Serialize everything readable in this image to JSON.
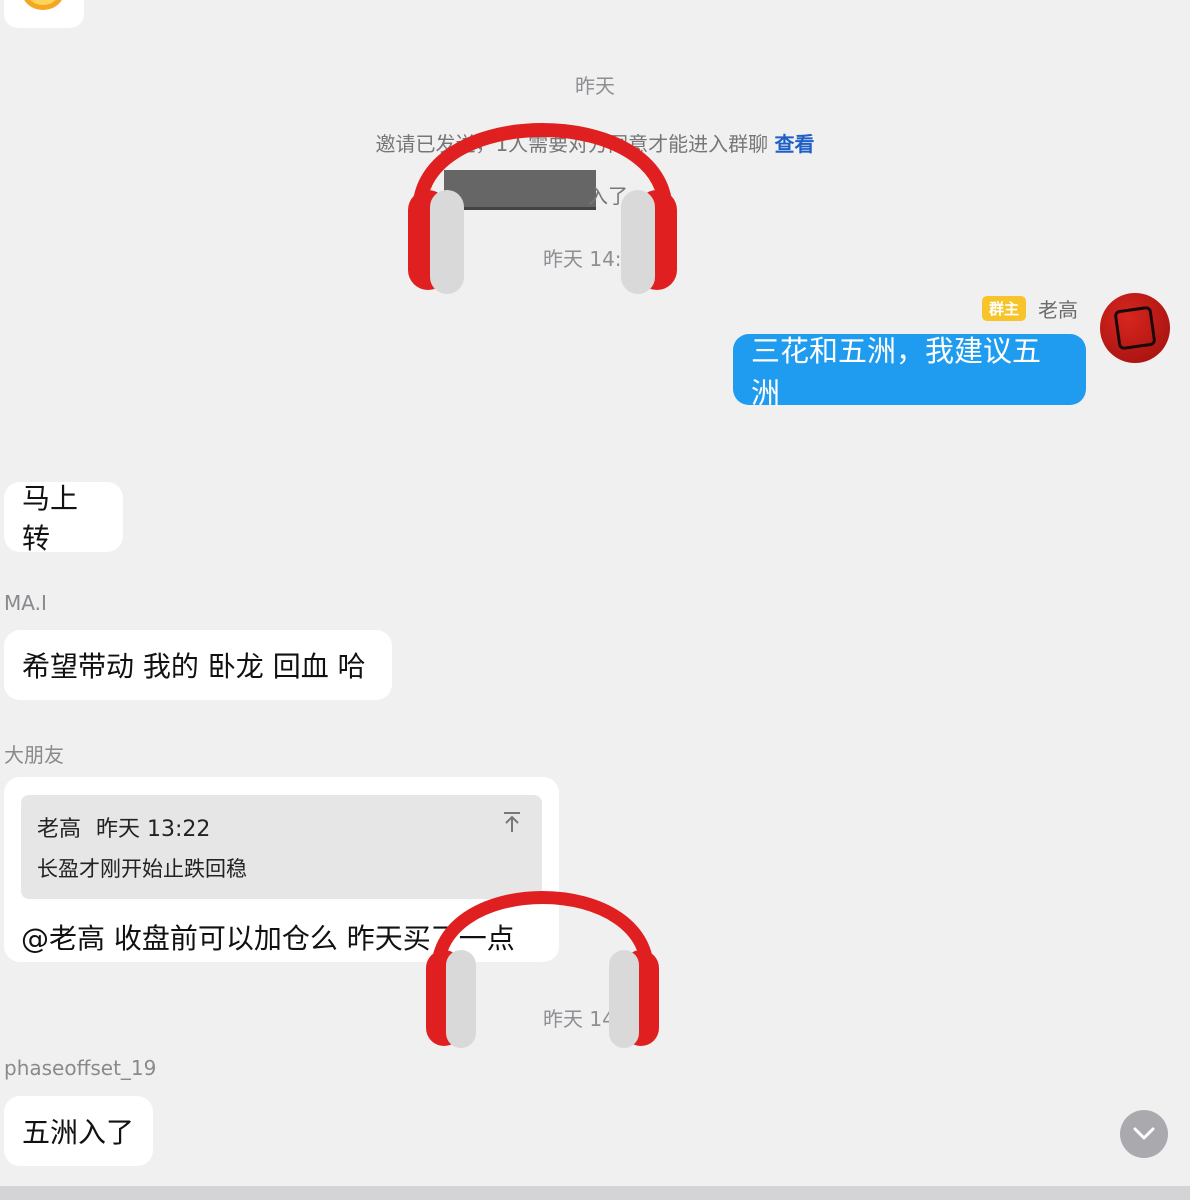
{
  "colors": {
    "background": "#f0f0f0",
    "my_bubble": "#1f9cf0",
    "owner_badge": "#f7c52b",
    "link": "#1f5fc8"
  },
  "system": {
    "time_partial": "昨天",
    "invite_notice": "邀请已发送，1人需要对方同意才能进入群聊",
    "invite_link": "查看",
    "joined_suffix": "入了",
    "time_1407": "昨天 14:07",
    "time_1438": "昨天 14:38"
  },
  "owner_message": {
    "badge": "群主",
    "name": "老高",
    "text": "三花和五洲，我建议五洲",
    "avatar_icon": "red-calligraphy-avatar"
  },
  "messages": [
    {
      "sender": "",
      "text": "马上转"
    },
    {
      "sender": "MA.I",
      "text": "希望带动 我的 卧龙  回血 哈"
    },
    {
      "sender": "大朋友",
      "quote": {
        "author": "老高",
        "time": "昨天 13:22",
        "text": "长盈才刚开始止跌回稳"
      },
      "text": "@老高 收盘前可以加仓么  昨天买了一点"
    },
    {
      "sender": "phaseoffset_19",
      "text": "五洲入了"
    }
  ],
  "icons": {
    "quote_jump": "arrow-up-to-top-icon",
    "scroll_down": "chevron-down-icon",
    "watermark": "headphones-icon"
  }
}
